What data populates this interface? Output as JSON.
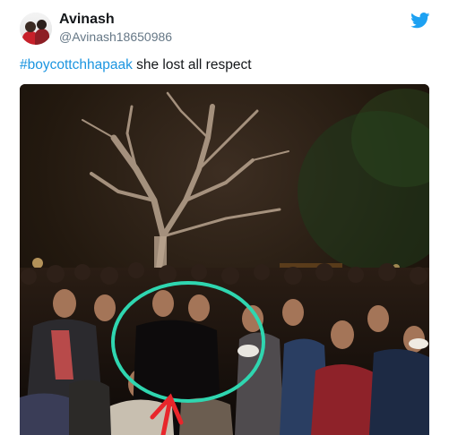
{
  "author": {
    "display_name": "Avinash",
    "handle": "@Avinash18650986",
    "avatar_icon": "profile-photo"
  },
  "brand": {
    "icon": "twitter-bird-icon",
    "color": "#1da1f2"
  },
  "tweet": {
    "hashtag": "#boycottchhapaak",
    "text": " she lost all respect",
    "hashtag_color": "#1b95e0"
  },
  "media": {
    "description_icon": "night-crowd-photo",
    "annotation_circle_color": "#2fd6b0",
    "annotation_arrow_color": "#e8262b"
  }
}
